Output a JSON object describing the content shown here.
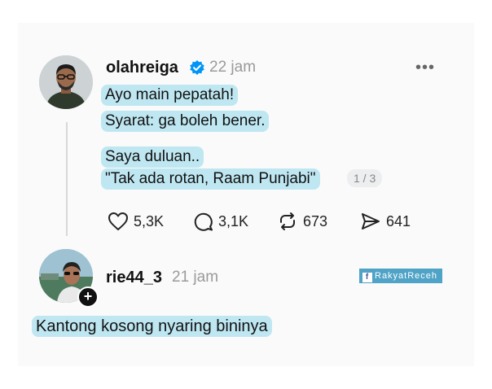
{
  "post": {
    "username": "olahreiga",
    "time": "22 jam",
    "lines": [
      "Ayo main pepatah!",
      "Syarat: ga boleh bener.",
      "Saya duluan..",
      "\"Tak ada rotan, Raam Punjabi\""
    ],
    "pager": "1 / 3",
    "actions": {
      "likes": "5,3K",
      "comments": "3,1K",
      "reposts": "673",
      "shares": "641"
    }
  },
  "reply": {
    "username": "rie44_3",
    "time": "21 jam",
    "text": "Kantong kosong nyaring bininya"
  },
  "watermark": {
    "logo": "f",
    "text": "RakyatReceh"
  },
  "icons": {
    "verified": "verified-badge-icon",
    "more": "more-options-icon",
    "like": "heart-icon",
    "comment": "comment-icon",
    "repost": "repost-icon",
    "share": "send-icon",
    "follow": "plus-icon"
  },
  "colors": {
    "highlight": "#bfe7f2",
    "verified": "#0095f6",
    "watermark": "#4fa3c7"
  }
}
